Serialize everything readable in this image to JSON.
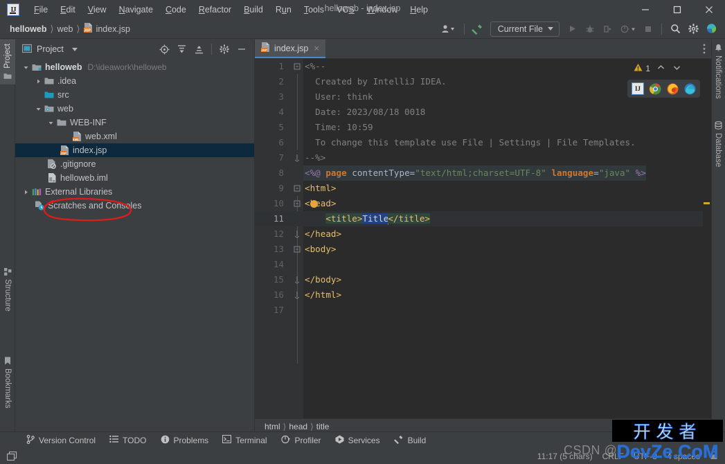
{
  "window": {
    "title": "helloweb - index.jsp",
    "minimize_label": "Minimize",
    "maximize_label": "Maximize",
    "close_label": "Close"
  },
  "menu": [
    {
      "label": "File"
    },
    {
      "label": "Edit"
    },
    {
      "label": "View"
    },
    {
      "label": "Navigate"
    },
    {
      "label": "Code"
    },
    {
      "label": "Refactor"
    },
    {
      "label": "Build"
    },
    {
      "label": "Run"
    },
    {
      "label": "Tools"
    },
    {
      "label": "VCS"
    },
    {
      "label": "Window"
    },
    {
      "label": "Help"
    }
  ],
  "navbar": {
    "crumbs": [
      {
        "label": "helloweb",
        "bold": true
      },
      {
        "label": "web",
        "bold": false
      },
      {
        "label": "index.jsp",
        "bold": false,
        "icon": "jsp-file-icon"
      }
    ],
    "run_config": "Current File",
    "icons": [
      "settings-sync-icon",
      "build-hammer-icon",
      "run-icon",
      "debug-icon",
      "run-with-coverage-icon",
      "profile-icon",
      "stop-icon",
      "search-everywhere-icon",
      "settings-gear-icon",
      "ide-notification-icon"
    ]
  },
  "left_strip": {
    "tabs": [
      {
        "label": "Project",
        "icon": "project-icon",
        "active": true
      },
      {
        "label": "Structure",
        "icon": "structure-icon",
        "active": false
      },
      {
        "label": "Bookmarks",
        "icon": "bookmark-icon",
        "active": false
      }
    ]
  },
  "right_strip": {
    "tabs": [
      {
        "label": "Notifications",
        "icon": "bell-icon"
      },
      {
        "label": "Database",
        "icon": "database-icon"
      }
    ]
  },
  "project_panel": {
    "title": "Project",
    "toolbar": [
      "select-opened-file-icon",
      "expand-all-icon",
      "collapse-all-icon",
      "gear-icon",
      "hide-icon"
    ],
    "tree": [
      {
        "label": "helloweb",
        "sub": "D:\\ideawork\\helloweb",
        "indent": 0,
        "arrow": "expanded",
        "icon": "module-icon",
        "bold": true,
        "selected": false
      },
      {
        "label": ".idea",
        "sub": "",
        "indent": 1,
        "arrow": "collapsed",
        "icon": "folder-icon",
        "bold": false,
        "selected": false
      },
      {
        "label": "src",
        "sub": "",
        "indent": 1,
        "arrow": "none",
        "icon": "source-folder-icon",
        "bold": false,
        "selected": false
      },
      {
        "label": "web",
        "sub": "",
        "indent": 1,
        "arrow": "expanded",
        "icon": "web-folder-icon",
        "bold": false,
        "selected": false
      },
      {
        "label": "WEB-INF",
        "sub": "",
        "indent": 2,
        "arrow": "expanded",
        "icon": "folder-icon",
        "bold": false,
        "selected": false
      },
      {
        "label": "web.xml",
        "sub": "",
        "indent": 3,
        "arrow": "none",
        "icon": "xml-file-icon",
        "bold": false,
        "selected": false
      },
      {
        "label": "index.jsp",
        "sub": "",
        "indent": 2,
        "arrow": "none",
        "icon": "jsp-file-icon",
        "bold": false,
        "selected": true
      },
      {
        "label": ".gitignore",
        "sub": "",
        "indent": 1,
        "arrow": "none",
        "icon": "gitignore-icon",
        "bold": false,
        "selected": false
      },
      {
        "label": "helloweb.iml",
        "sub": "",
        "indent": 1,
        "arrow": "none",
        "icon": "iml-file-icon",
        "bold": false,
        "selected": false
      },
      {
        "label": "External Libraries",
        "sub": "",
        "indent": 0,
        "arrow": "collapsed",
        "icon": "libraries-icon",
        "bold": false,
        "selected": false
      },
      {
        "label": "Scratches and Consoles",
        "sub": "",
        "indent": 0,
        "arrow": "none",
        "icon": "scratches-icon",
        "bold": false,
        "selected": false
      }
    ]
  },
  "editor": {
    "tab": {
      "label": "index.jsp",
      "icon": "jsp-file-icon",
      "close": "×"
    },
    "warning_count": "1",
    "warning_icon": "warning-triangle-icon",
    "browsers": [
      "intellij-preview-icon",
      "chrome-icon",
      "firefox-icon",
      "edge-icon"
    ],
    "lines": [
      {
        "n": "1",
        "fold": "fold-end-open",
        "text": "<%--",
        "style": "comment"
      },
      {
        "n": "2",
        "fold": "",
        "text": "  Created by IntelliJ IDEA.",
        "style": "comment"
      },
      {
        "n": "3",
        "fold": "",
        "text": "  User: think",
        "style": "comment"
      },
      {
        "n": "4",
        "fold": "",
        "text": "  Date: 2023/08/18 0018",
        "style": "comment"
      },
      {
        "n": "5",
        "fold": "",
        "text": "  Time: 10:59",
        "style": "comment"
      },
      {
        "n": "6",
        "fold": "",
        "text": "  To change this template use File | Settings | File Templates.",
        "style": "comment"
      },
      {
        "n": "7",
        "fold": "fold-close",
        "text": "--%>",
        "style": "comment"
      },
      {
        "n": "8",
        "fold": "",
        "text": "<%@ page contentType=\"text/html;charset=UTF-8\" language=\"java\" %>",
        "style": "directive"
      },
      {
        "n": "9",
        "fold": "fold-open",
        "text": "<html>",
        "style": "tag"
      },
      {
        "n": "10",
        "fold": "fold-open",
        "text": "<head>",
        "style": "tag"
      },
      {
        "n": "11",
        "fold": "",
        "text": "    <title>Title</title>",
        "style": "title-selected"
      },
      {
        "n": "12",
        "fold": "fold-close",
        "text": "</head>",
        "style": "tag"
      },
      {
        "n": "13",
        "fold": "fold-open",
        "text": "<body>",
        "style": "tag"
      },
      {
        "n": "14",
        "fold": "",
        "text": "",
        "style": "plain"
      },
      {
        "n": "15",
        "fold": "fold-close",
        "text": "</body>",
        "style": "tag"
      },
      {
        "n": "16",
        "fold": "fold-close",
        "text": "</html>",
        "style": "tag"
      },
      {
        "n": "17",
        "fold": "",
        "text": "",
        "style": "plain"
      }
    ],
    "selected_text": "Title",
    "breadcrumbs": [
      "html",
      "head",
      "title"
    ]
  },
  "tool_windows": [
    {
      "label": "Version Control",
      "icon": "vcs-branch-icon"
    },
    {
      "label": "TODO",
      "icon": "todo-list-icon"
    },
    {
      "label": "Problems",
      "icon": "problems-icon"
    },
    {
      "label": "Terminal",
      "icon": "terminal-icon"
    },
    {
      "label": "Profiler",
      "icon": "profiler-icon"
    },
    {
      "label": "Services",
      "icon": "services-icon"
    },
    {
      "label": "Build",
      "icon": "build-hammer-icon"
    }
  ],
  "statusbar": {
    "left_icon": "layout-icon",
    "caret": "11:17 (5 chars)",
    "line_separator": "CRLF",
    "encoding": "UTF-8",
    "indent": "4 spaces",
    "lock_icon": "read-write-icon"
  },
  "watermark": {
    "csdn": "CSDN @",
    "cn": "开发者",
    "en": "DevZe.CoM"
  },
  "colors": {
    "accent_blue": "#4a88c7",
    "selection_blue": "#214283",
    "tree_selection": "#0d293e",
    "annotation_red": "#e01b1b",
    "warning_yellow": "#d5a526",
    "panel_bg": "#3c3f41",
    "editor_bg": "#2b2b2b"
  }
}
